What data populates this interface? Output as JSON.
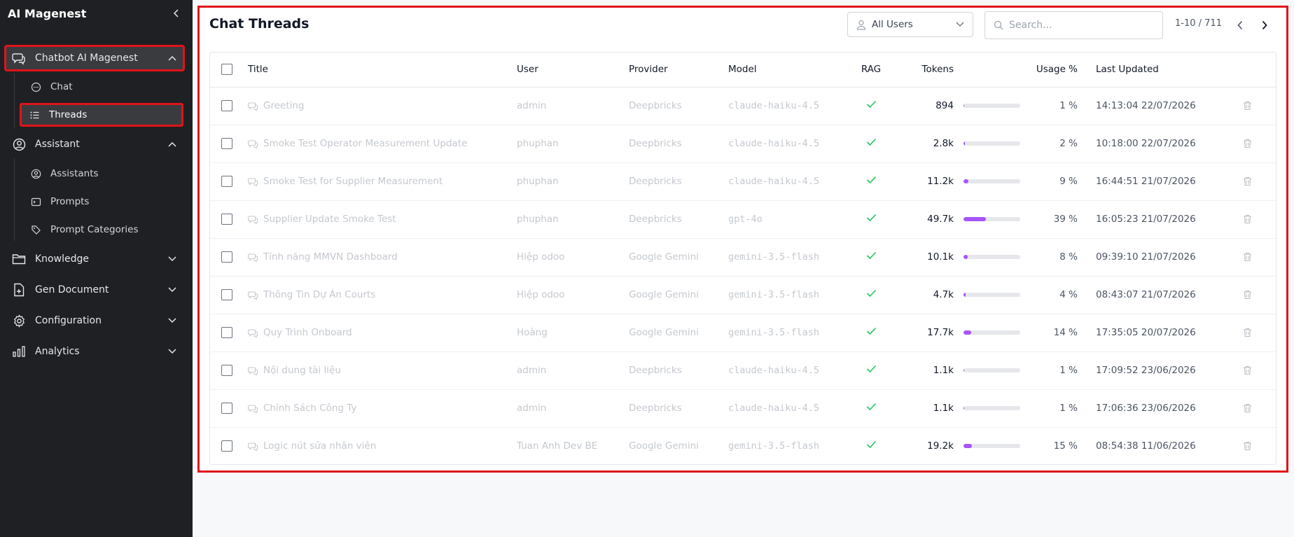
{
  "sidebar": {
    "title": "AI Magenest",
    "groups": {
      "chatbot": {
        "label": "Chatbot AI Magenest"
      },
      "assistant": {
        "label": "Assistant"
      },
      "knowledge": {
        "label": "Knowledge"
      },
      "gen_document": {
        "label": "Gen Document"
      },
      "configuration": {
        "label": "Configuration"
      },
      "analytics": {
        "label": "Analytics"
      }
    },
    "subitems": {
      "chat": {
        "label": "Chat"
      },
      "threads": {
        "label": "Threads"
      },
      "assistants": {
        "label": "Assistants"
      },
      "prompts": {
        "label": "Prompts"
      },
      "prompt_categories": {
        "label": "Prompt Categories"
      }
    }
  },
  "main": {
    "title": "Chat Threads",
    "user_filter": "All Users",
    "search_placeholder": "Search...",
    "pagination": "1-10 / 711"
  },
  "colors": {
    "accent": "#a855f7",
    "check": "#22c55e",
    "highlight_border": "#e0131a",
    "sidebar_bg": "#1f2023"
  },
  "table": {
    "headers": {
      "title": "Title",
      "user": "User",
      "provider": "Provider",
      "model": "Model",
      "rag": "RAG",
      "tokens": "Tokens",
      "usage": "Usage %",
      "updated": "Last Updated"
    },
    "rows": [
      {
        "title": "Greeting",
        "user": "admin",
        "provider": "Deepbricks",
        "model": "claude-haiku-4.5",
        "tokens": "894",
        "usage": 1,
        "usage_label": "1 %",
        "updated": "14:13:04 22/07/2026"
      },
      {
        "title": "Smoke Test Operator Measurement Update",
        "user": "phuphan",
        "provider": "Deepbricks",
        "model": "claude-haiku-4.5",
        "tokens": "2.8k",
        "usage": 2,
        "usage_label": "2 %",
        "updated": "10:18:00 22/07/2026"
      },
      {
        "title": "Smoke Test for Supplier Measurement",
        "user": "phuphan",
        "provider": "Deepbricks",
        "model": "claude-haiku-4.5",
        "tokens": "11.2k",
        "usage": 9,
        "usage_label": "9 %",
        "updated": "16:44:51 21/07/2026"
      },
      {
        "title": "Supplier Update Smoke Test",
        "user": "phuphan",
        "provider": "Deepbricks",
        "model": "gpt-4o",
        "tokens": "49.7k",
        "usage": 39,
        "usage_label": "39 %",
        "updated": "16:05:23 21/07/2026"
      },
      {
        "title": "Tính năng MMVN Dashboard",
        "user": "Hiệp odoo",
        "provider": "Google Gemini",
        "model": "gemini-3.5-flash",
        "tokens": "10.1k",
        "usage": 8,
        "usage_label": "8 %",
        "updated": "09:39:10 21/07/2026"
      },
      {
        "title": "Thông Tin Dự Án Courts",
        "user": "Hiệp odoo",
        "provider": "Google Gemini",
        "model": "gemini-3.5-flash",
        "tokens": "4.7k",
        "usage": 4,
        "usage_label": "4 %",
        "updated": "08:43:07 21/07/2026"
      },
      {
        "title": "Quy Trình Onboard",
        "user": "Hoàng",
        "provider": "Google Gemini",
        "model": "gemini-3.5-flash",
        "tokens": "17.7k",
        "usage": 14,
        "usage_label": "14 %",
        "updated": "17:35:05 20/07/2026"
      },
      {
        "title": "Nội dung tài liệu",
        "user": "admin",
        "provider": "Deepbricks",
        "model": "claude-haiku-4.5",
        "tokens": "1.1k",
        "usage": 1,
        "usage_label": "1 %",
        "updated": "17:09:52 23/06/2026"
      },
      {
        "title": "Chính Sách Công Ty",
        "user": "admin",
        "provider": "Deepbricks",
        "model": "claude-haiku-4.5",
        "tokens": "1.1k",
        "usage": 1,
        "usage_label": "1 %",
        "updated": "17:06:36 23/06/2026"
      },
      {
        "title": "Logic nút sửa nhân viên",
        "user": "Tuan Anh Dev BE",
        "provider": "Google Gemini",
        "model": "gemini-3.5-flash",
        "tokens": "19.2k",
        "usage": 15,
        "usage_label": "15 %",
        "updated": "08:54:38 11/06/2026"
      }
    ]
  }
}
